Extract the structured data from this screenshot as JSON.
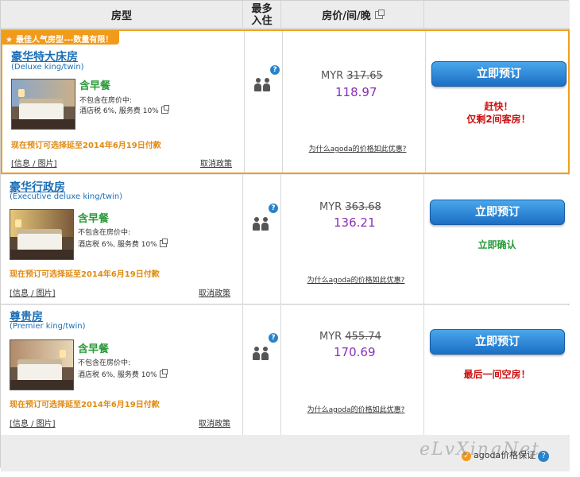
{
  "header": {
    "room_type": "房型",
    "max_occ_line1": "最多",
    "max_occ_line2": "入住",
    "price": "房价/间/晚"
  },
  "rooms": [
    {
      "ribbon": "最佳人气房型---数量有限！",
      "name": "豪华特大床房",
      "sub": "(Deluxe king/twin)",
      "breakfast": "含早餐",
      "tax_line1": "不包含在房价中:",
      "tax_line2": "酒店税 6%, 服务费 10%",
      "defer": "现在预订可选择延至2014年6月19日付款",
      "info_link": "[信息 / 图片]",
      "cancel_link": "取消政策",
      "currency": "MYR",
      "old_price": "317.65",
      "new_price": "118.97",
      "why_link": "为什么agoda的价格如此优惠?",
      "book_label": "立即预订",
      "note_line1": "赶快！",
      "note_line2": "仅剩2间客房！",
      "note_color": "#cc1111"
    },
    {
      "name": "豪华行政房",
      "sub": "(Executive deluxe king/twin)",
      "breakfast": "含早餐",
      "tax_line1": "不包含在房价中:",
      "tax_line2": "酒店税 6%, 服务费 10%",
      "defer": "现在预订可选择延至2014年6月19日付款",
      "info_link": "[信息 / 图片]",
      "cancel_link": "取消政策",
      "currency": "MYR",
      "old_price": "363.68",
      "new_price": "136.21",
      "why_link": "为什么agoda的价格如此优惠?",
      "book_label": "立即预订",
      "note_line1": "立即确认",
      "note_color": "#2a9a3a"
    },
    {
      "name": "尊贵房",
      "sub": "(Premier king/twin)",
      "breakfast": "含早餐",
      "tax_line1": "不包含在房价中:",
      "tax_line2": "酒店税 6%, 服务费 10%",
      "defer": "现在预订可选择延至2014年6月19日付款",
      "info_link": "[信息 / 图片]",
      "cancel_link": "取消政策",
      "currency": "MYR",
      "old_price": "455.74",
      "new_price": "170.69",
      "why_link": "为什么agoda的价格如此优惠?",
      "book_label": "立即预订",
      "note_line1": "最后一间空房！",
      "note_color": "#cc1111"
    }
  ],
  "footer": {
    "guarantee": "agoda价格保证",
    "watermark": "eLvXingNet"
  },
  "colors": {
    "accent_blue": "#1b6eb5",
    "orange": "#f29a1a",
    "price_purple": "#8a2fb8",
    "green": "#2a9a3a",
    "red": "#cc1111"
  }
}
